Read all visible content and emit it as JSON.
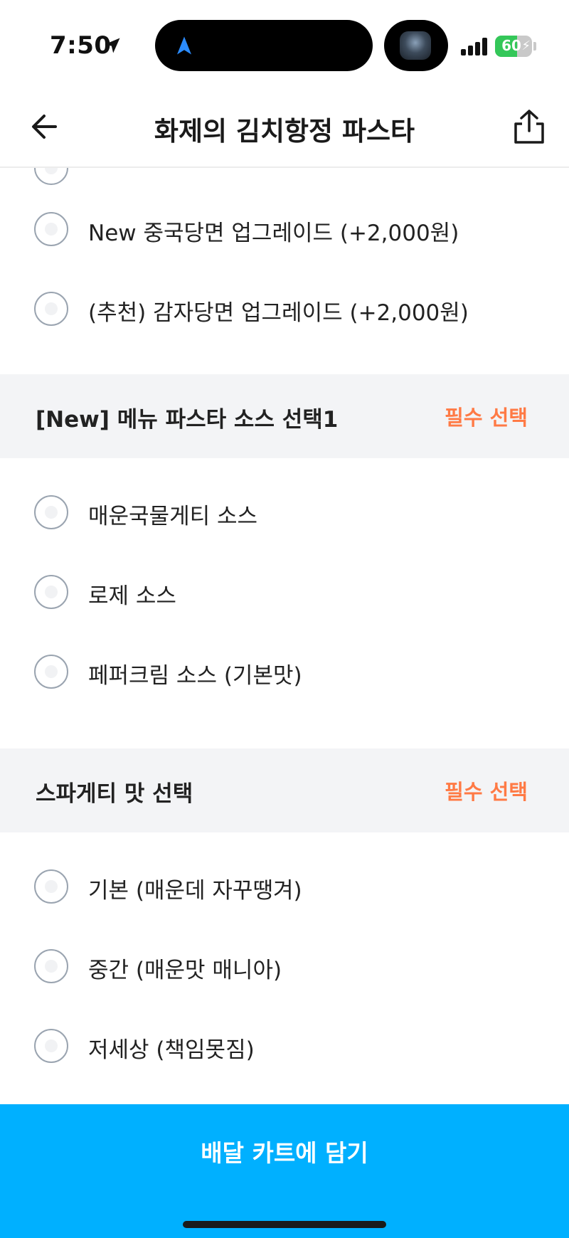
{
  "status_bar": {
    "time": "7:50",
    "battery": "60",
    "battery_level": 0.6
  },
  "header": {
    "title": "화제의 김치항정 파스타"
  },
  "top_options": [
    {
      "label": "New 중국당면 업그레이드 (+2,000원)"
    },
    {
      "label": "(추천) 감자당면 업그레이드 (+2,000원)"
    }
  ],
  "sections": [
    {
      "title": "[New] 메뉴 파스타 소스 선택1",
      "badge": "필수 선택",
      "options": [
        {
          "label": "매운국물게티 소스"
        },
        {
          "label": "로제 소스"
        },
        {
          "label": "페퍼크림 소스 (기본맛)"
        }
      ]
    },
    {
      "title": "스파게티 맛 선택",
      "badge": "필수 선택",
      "options": [
        {
          "label": "기본 (매운데 자꾸땡겨)"
        },
        {
          "label": "중간 (매운맛 매니아)"
        },
        {
          "label": "저세상 (책임못짐)"
        }
      ]
    }
  ],
  "cart_button": {
    "label": "배달 카트에 담기"
  },
  "colors": {
    "accent": "#00B0FF",
    "required_badge": "#FF7A45",
    "section_bg": "#F3F4F6"
  }
}
